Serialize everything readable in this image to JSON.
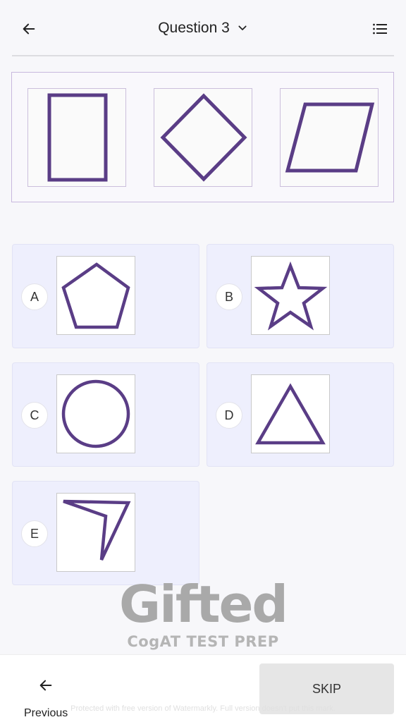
{
  "header": {
    "title": "Question 3",
    "back_icon": "arrow-left-icon",
    "dropdown_icon": "chevron-down-icon",
    "menu_icon": "list-icon"
  },
  "question": {
    "figures": [
      "rectangle",
      "diamond",
      "parallelogram"
    ]
  },
  "options": [
    {
      "letter": "A",
      "figure": "pentagon"
    },
    {
      "letter": "B",
      "figure": "star"
    },
    {
      "letter": "C",
      "figure": "circle"
    },
    {
      "letter": "D",
      "figure": "triangle"
    },
    {
      "letter": "E",
      "figure": "arrowhead"
    }
  ],
  "watermark": {
    "logo": "Gifted",
    "subtitle": "CogAT TEST PREP"
  },
  "footer": {
    "previous_label": "Previous",
    "skip_label": "SKIP",
    "note": "Protected with free version of Watermarkly. Full version doesn't put this mark."
  },
  "colors": {
    "shape_stroke": "#5a3d86",
    "option_bg": "#eeeffd",
    "skip_bg": "#e6e6e6"
  }
}
